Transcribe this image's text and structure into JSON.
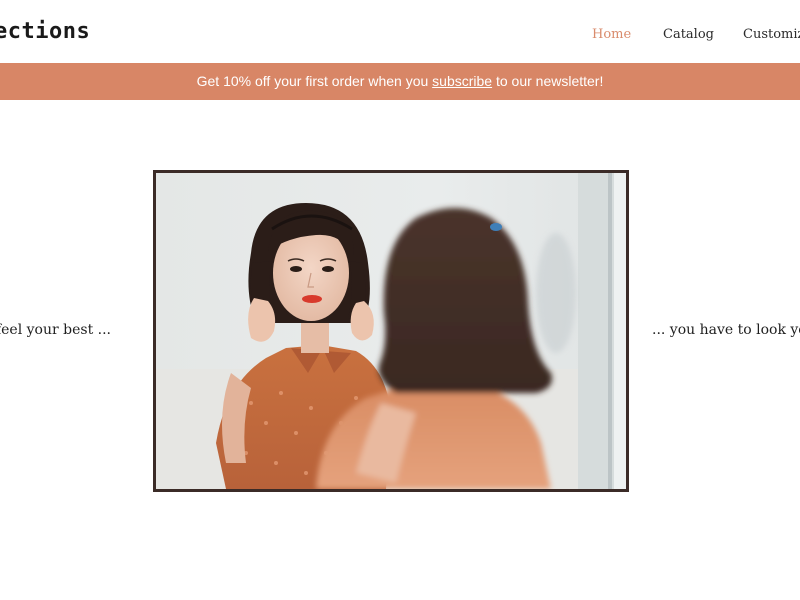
{
  "header": {
    "logo": "ections",
    "nav": [
      {
        "label": "Home",
        "active": true
      },
      {
        "label": "Catalog",
        "active": false
      },
      {
        "label": "Customize",
        "active": false
      }
    ]
  },
  "banner": {
    "text_before": "Get 10% off your first order when you ",
    "link": "subscribe",
    "text_after": " to our newsletter!",
    "background_color": "#d88666"
  },
  "hero": {
    "left_text": "o feel your best ...",
    "right_text": "... you have to look you",
    "image_alt": "Woman with red lipstick looking at herself in a mirror"
  },
  "colors": {
    "accent": "#d88666",
    "nav_active": "#d98b6c",
    "frame": "#3b2b27"
  }
}
